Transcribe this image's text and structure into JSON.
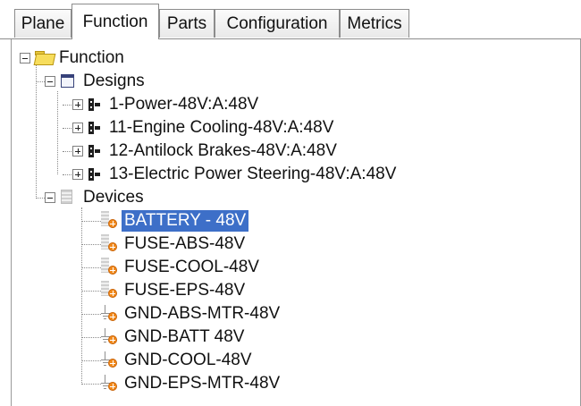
{
  "tabs": [
    {
      "label": "Plane",
      "active": false
    },
    {
      "label": "Function",
      "active": true
    },
    {
      "label": "Parts",
      "active": false
    },
    {
      "label": "Configuration",
      "active": false
    },
    {
      "label": "Metrics",
      "active": false
    }
  ],
  "tree": {
    "root": {
      "label": "Function",
      "icon": "folder-icon",
      "expanded": true
    },
    "designs": {
      "label": "Designs",
      "icon": "designs-icon",
      "expanded": true,
      "items": [
        {
          "label": "1-Power-48V:A:48V",
          "icon": "schematic-icon",
          "expanded": false
        },
        {
          "label": "11-Engine Cooling-48V:A:48V",
          "icon": "schematic-icon",
          "expanded": false
        },
        {
          "label": "12-Antilock Brakes-48V:A:48V",
          "icon": "schematic-icon",
          "expanded": false
        },
        {
          "label": "13-Electric Power Steering-48V:A:48V",
          "icon": "schematic-icon",
          "expanded": false
        }
      ]
    },
    "devices": {
      "label": "Devices",
      "icon": "devices-icon",
      "expanded": true,
      "items": [
        {
          "label": "BATTERY - 48V",
          "icon": "fuse-device-icon",
          "selected": true
        },
        {
          "label": "FUSE-ABS-48V",
          "icon": "fuse-device-icon"
        },
        {
          "label": "FUSE-COOL-48V",
          "icon": "fuse-device-icon"
        },
        {
          "label": "FUSE-EPS-48V",
          "icon": "fuse-device-icon"
        },
        {
          "label": "GND-ABS-MTR-48V",
          "icon": "ground-device-icon"
        },
        {
          "label": "GND-BATT 48V",
          "icon": "ground-device-icon"
        },
        {
          "label": "GND-COOL-48V",
          "icon": "ground-device-icon"
        },
        {
          "label": "GND-EPS-MTR-48V",
          "icon": "ground-device-icon"
        }
      ]
    }
  },
  "colors": {
    "selection": "#3d6fc8",
    "folder": "#f7dd5c",
    "badge": "#f28a1c"
  }
}
